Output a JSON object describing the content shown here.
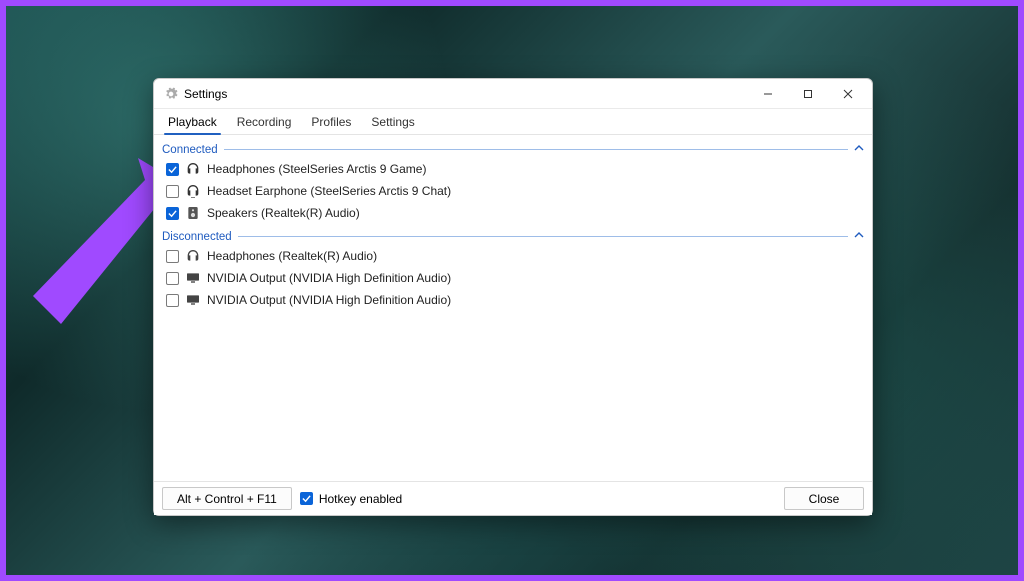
{
  "window": {
    "title": "Settings"
  },
  "tabs": [
    {
      "label": "Playback",
      "selected": true
    },
    {
      "label": "Recording",
      "selected": false
    },
    {
      "label": "Profiles",
      "selected": false
    },
    {
      "label": "Settings",
      "selected": false
    }
  ],
  "groups": {
    "connected": {
      "label": "Connected",
      "items": [
        {
          "checked": true,
          "icon": "headphones-icon",
          "label": "Headphones (SteelSeries Arctis 9 Game)"
        },
        {
          "checked": false,
          "icon": "headset-icon",
          "label": "Headset Earphone (SteelSeries Arctis 9 Chat)"
        },
        {
          "checked": true,
          "icon": "speaker-icon",
          "label": "Speakers (Realtek(R) Audio)"
        }
      ]
    },
    "disconnected": {
      "label": "Disconnected",
      "items": [
        {
          "checked": false,
          "icon": "headphones-icon",
          "label": "Headphones (Realtek(R) Audio)"
        },
        {
          "checked": false,
          "icon": "monitor-icon",
          "label": "NVIDIA Output (NVIDIA High Definition Audio)"
        },
        {
          "checked": false,
          "icon": "monitor-icon",
          "label": "NVIDIA Output (NVIDIA High Definition Audio)"
        }
      ]
    }
  },
  "footer": {
    "hotkey_button": "Alt + Control + F11",
    "hotkey_enabled_label": "Hotkey enabled",
    "hotkey_enabled_checked": true,
    "close_button": "Close"
  },
  "annotation": {
    "kind": "arrow",
    "color": "#a04aff"
  }
}
